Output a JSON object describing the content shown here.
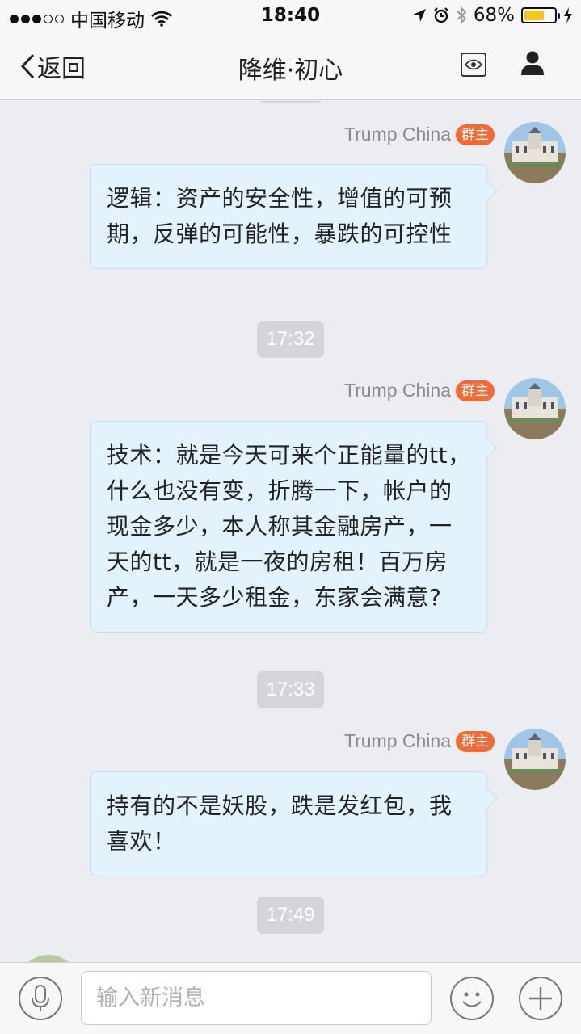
{
  "status_bar": {
    "carrier": "中国移动",
    "time": "18:40",
    "battery": "68%",
    "battery_level": 0.68
  },
  "nav": {
    "back_label": "返回",
    "title": "降维·初心",
    "eye_icon": "eye-icon",
    "user_icon": "person-icon"
  },
  "messages": [
    {
      "sender": "Trump China",
      "badge": "群主",
      "text": "逻辑：资产的安全性，增值的可预期，反弹的可能性，暴跌的可控性"
    },
    {
      "time": "17:32"
    },
    {
      "sender": "Trump China",
      "badge": "群主",
      "text": "技术：就是今天可来个正能量的tt，什么也没有变，折腾一下，帐户的现金多少，本人称其金融房产，一天的tt，就是一夜的房租！百万房产，一天多少租金，东家会满意?"
    },
    {
      "time": "17:33"
    },
    {
      "sender": "Trump China",
      "badge": "群主",
      "text": "持有的不是妖股，跌是发红包，我喜欢！"
    },
    {
      "time": "17:49"
    }
  ],
  "input": {
    "placeholder": "输入新消息"
  },
  "colors": {
    "bubble_bg": "#e3f3fd",
    "badge": "#f26a34",
    "background": "#ebedf0",
    "battery": "#f5c71a"
  }
}
